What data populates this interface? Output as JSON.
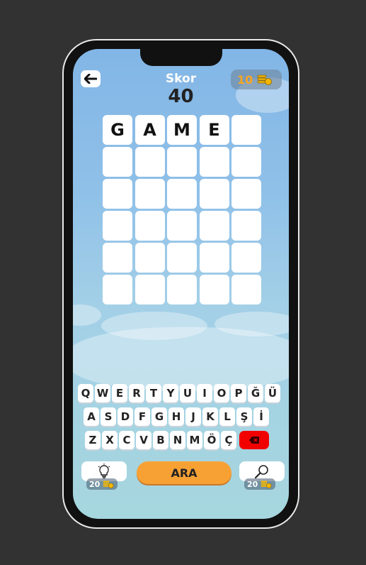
{
  "header": {
    "score_label": "Skor",
    "score_value": "40",
    "coins": "10"
  },
  "icons": {
    "back": "arrow-left-icon",
    "coin": "coin-stack-icon",
    "hint": "lightbulb-icon",
    "search": "magnifier-icon",
    "delete": "backspace-icon"
  },
  "board": {
    "rows": [
      [
        "G",
        "A",
        "M",
        "E",
        ""
      ],
      [
        "",
        "",
        "",
        "",
        ""
      ],
      [
        "",
        "",
        "",
        "",
        ""
      ],
      [
        "",
        "",
        "",
        "",
        ""
      ],
      [
        "",
        "",
        "",
        "",
        ""
      ],
      [
        "",
        "",
        "",
        "",
        ""
      ]
    ]
  },
  "keyboard": {
    "row1": [
      "Q",
      "W",
      "E",
      "R",
      "T",
      "Y",
      "U",
      "I",
      "O",
      "P",
      "Ğ",
      "Ü"
    ],
    "row2": [
      "A",
      "S",
      "D",
      "F",
      "G",
      "H",
      "J",
      "K",
      "L",
      "Ş",
      "İ"
    ],
    "row3": [
      "Z",
      "X",
      "C",
      "V",
      "B",
      "N",
      "M",
      "Ö",
      "Ç"
    ]
  },
  "actions": {
    "hint_price": "20",
    "search_label": "ARA",
    "reveal_price": "20"
  },
  "colors": {
    "accent": "#f7a135",
    "delete": "#f20000",
    "coin": "#f5a623"
  }
}
